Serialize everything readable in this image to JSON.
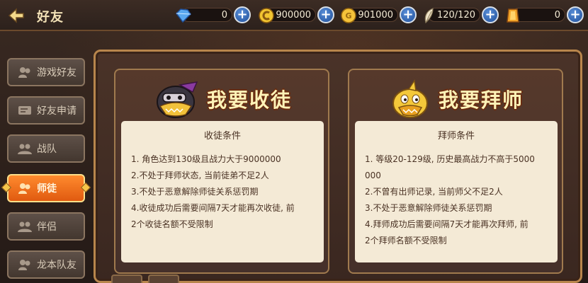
{
  "header": {
    "title": "好友",
    "back_icon": "back-arrow-icon"
  },
  "currencies": [
    {
      "name": "diamond",
      "icon": "diamond-icon",
      "value": "0"
    },
    {
      "name": "coupon",
      "icon": "coupon-icon",
      "value": "900000"
    },
    {
      "name": "gold",
      "icon": "gold-coin-icon",
      "value": "901000"
    },
    {
      "name": "stamina",
      "icon": "feather-icon",
      "value": "120/120"
    },
    {
      "name": "token",
      "icon": "gold-bar-icon",
      "value": "0"
    }
  ],
  "nav": {
    "items": [
      {
        "label": "游戏好友",
        "icon": "friends-icon"
      },
      {
        "label": "好友申请",
        "icon": "request-icon"
      },
      {
        "label": "战队",
        "icon": "team-icon"
      },
      {
        "label": "师徒",
        "icon": "mentor-icon",
        "active": true
      },
      {
        "label": "伴侣",
        "icon": "partner-icon"
      },
      {
        "label": "龙本队友",
        "icon": "dragon-team-icon"
      }
    ]
  },
  "cards": {
    "apprentice": {
      "title": "我要收徒",
      "conditions_title": "收徒条件",
      "lines": [
        "1. 角色达到130级且战力大于9000000",
        "2.不处于拜师状态, 当前徒弟不足2人",
        "3.不处于恶意解除师徒关系惩罚期",
        "4.收徒成功后需要间隔7天才能再次收徒, 前",
        "2个收徒名额不受限制"
      ]
    },
    "master": {
      "title": "我要拜师",
      "conditions_title": "拜师条件",
      "lines": [
        "1. 等级20-129级, 历史最高战力不高于5000",
        "000",
        "2.不曾有出师记录, 当前师父不足2人",
        "3.不处于恶意解除师徒关系惩罚期",
        "4.拜师成功后需要间隔7天才能再次拜师, 前",
        "2个拜师名额不受限制"
      ]
    }
  },
  "colors": {
    "accent": "#e05a10",
    "paper": "#f4ead6",
    "frame": "#b8864c"
  }
}
